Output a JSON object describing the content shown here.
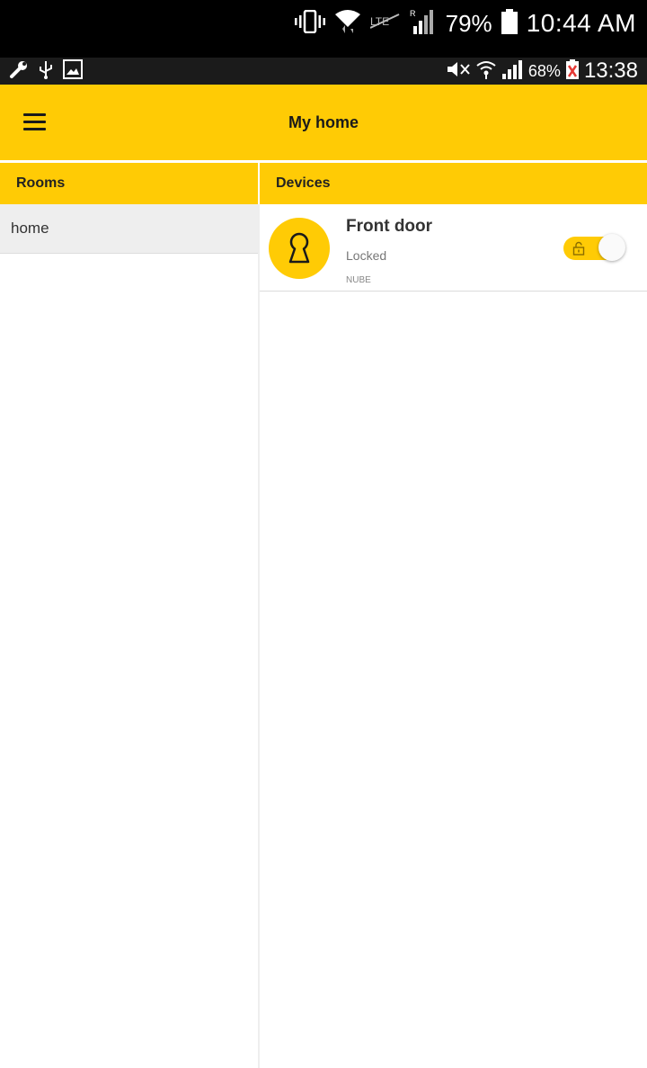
{
  "system_status": {
    "battery_percent": "79%",
    "time": "10:44 AM",
    "icons": [
      "vibrate-icon",
      "wifi-icon",
      "lte-icon",
      "signal-icon",
      "battery-icon"
    ]
  },
  "inner_status": {
    "left_icons": [
      "wrench-icon",
      "usb-icon",
      "image-icon"
    ],
    "battery_percent": "68%",
    "time": "13:38",
    "icons": [
      "mute-icon",
      "wifi-icon",
      "signal-icon",
      "battery-alert-icon"
    ]
  },
  "appbar": {
    "title": "My home",
    "menu_icon": "hamburger-menu-icon"
  },
  "rooms": {
    "header": "Rooms",
    "items": [
      {
        "label": "home",
        "selected": true
      }
    ]
  },
  "devices": {
    "header": "Devices",
    "items": [
      {
        "name": "Front door",
        "status": "Locked",
        "maker": "NUBE",
        "icon": "keyhole-icon",
        "toggle_on": true,
        "toggle_icon": "padlock-icon"
      }
    ]
  },
  "colors": {
    "accent": "#ffcb05",
    "status_bar": "#000000",
    "inner_status_bar": "#1b1b1b",
    "selected_row": "#eeeeee"
  }
}
